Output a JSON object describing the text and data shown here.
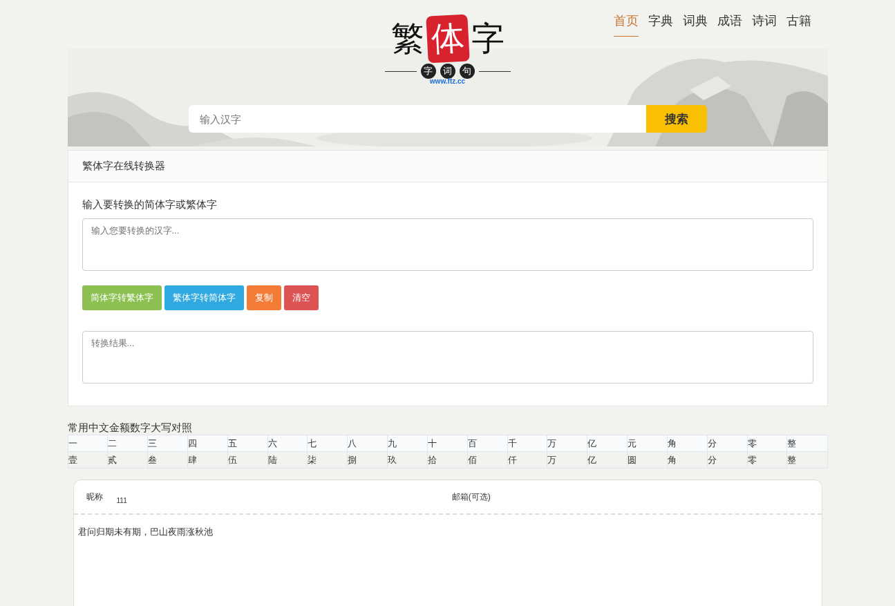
{
  "logo": {
    "main": [
      "繁",
      "体",
      "字"
    ],
    "seals": [
      "字",
      "词",
      "句"
    ],
    "url": "www.ftz.cc"
  },
  "nav": [
    {
      "label": "首页",
      "selected": true
    },
    {
      "label": "字典",
      "selected": false
    },
    {
      "label": "词典",
      "selected": false
    },
    {
      "label": "成语",
      "selected": false
    },
    {
      "label": "诗词",
      "selected": false
    },
    {
      "label": "古籍",
      "selected": false
    }
  ],
  "search": {
    "placeholder": "输入汉字",
    "button": "搜索"
  },
  "converter": {
    "title": "繁体字在线转换器",
    "prompt": "输入要转换的简体字或繁体字",
    "input_placeholder": "输入您要转换的汉字...",
    "buttons": [
      {
        "label": "简体字转繁体字",
        "color": "#8cc152"
      },
      {
        "label": "繁体字转简体字",
        "color": "#2fa9e0"
      },
      {
        "label": "复制",
        "color": "#f47c36"
      },
      {
        "label": "清空",
        "color": "#dd5353"
      }
    ],
    "result_placeholder": "转换结果..."
  },
  "numerals": {
    "title": "常用中文金额数字大写对照",
    "rows": [
      [
        "一",
        "二",
        "三",
        "四",
        "五",
        "六",
        "七",
        "八",
        "九",
        "十",
        "百",
        "千",
        "万",
        "亿",
        "元",
        "角",
        "分",
        "零",
        "整"
      ],
      [
        "壹",
        "贰",
        "叁",
        "肆",
        "伍",
        "陆",
        "柒",
        "捌",
        "玖",
        "拾",
        "佰",
        "仟",
        "万",
        "亿",
        "圆",
        "角",
        "分",
        "零",
        "整"
      ]
    ]
  },
  "comment": {
    "nickname_label": "昵称",
    "nickname": "111",
    "email_label": "邮箱(可选)",
    "content": "君问归期未有期，巴山夜雨涨秋池"
  }
}
